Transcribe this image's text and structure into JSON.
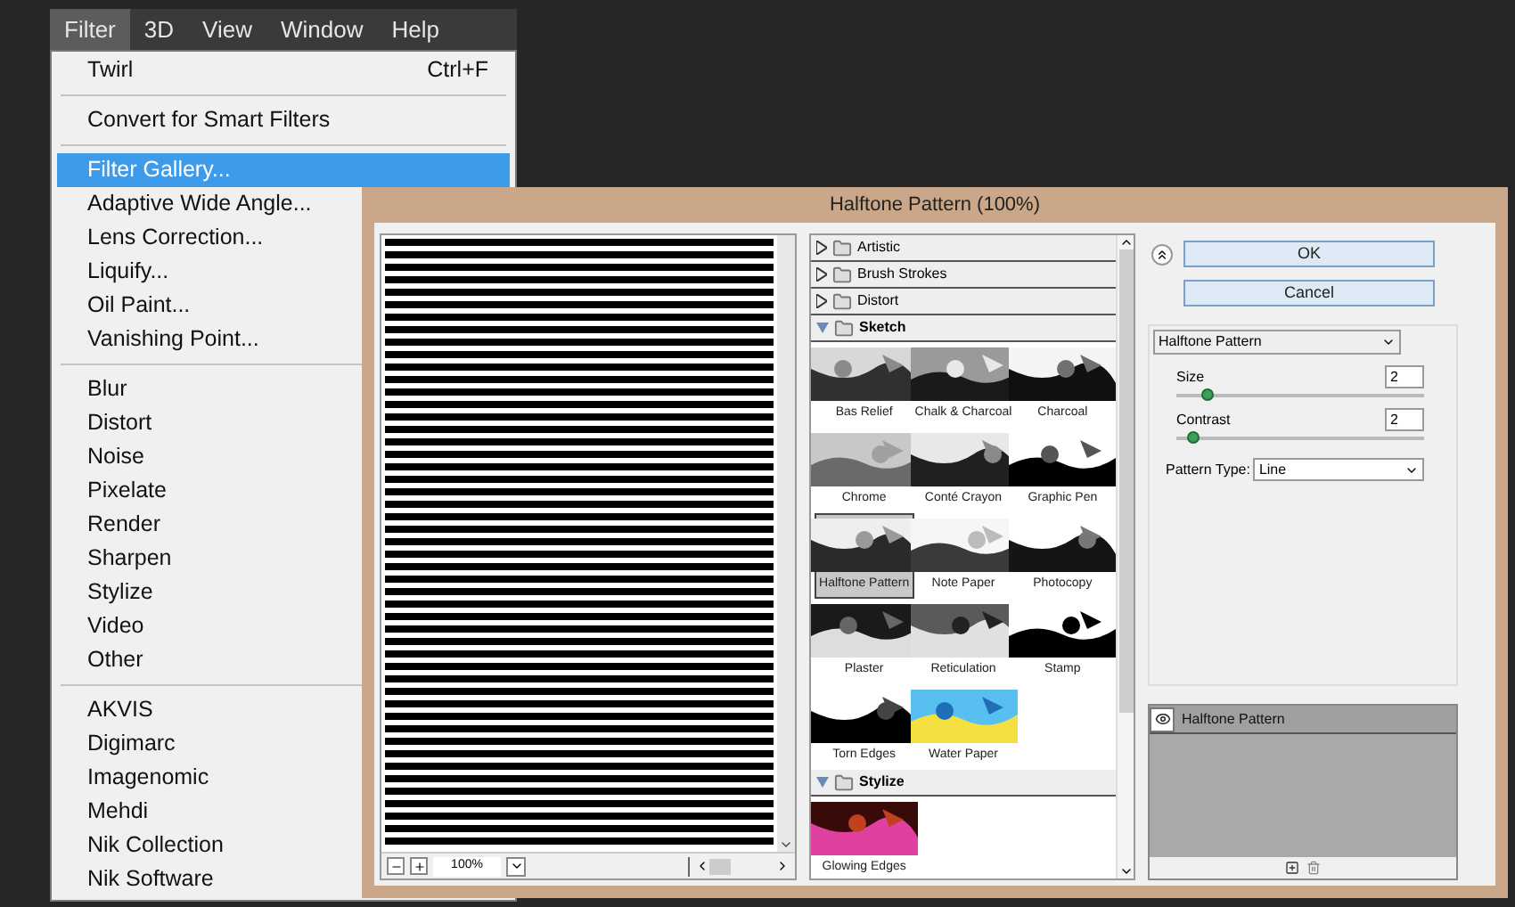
{
  "menu_bar": [
    {
      "label": "Filter",
      "selected": true
    },
    {
      "label": "3D",
      "selected": false
    },
    {
      "label": "View",
      "selected": false
    },
    {
      "label": "Window",
      "selected": false
    },
    {
      "label": "Help",
      "selected": false
    }
  ],
  "menu": {
    "groups": [
      [
        {
          "label": "Twirl",
          "shortcut": "Ctrl+F",
          "selected": false
        }
      ],
      [
        {
          "label": "Convert for Smart Filters",
          "selected": false
        }
      ],
      [
        {
          "label": "Filter Gallery...",
          "selected": true
        },
        {
          "label": "Adaptive Wide Angle...",
          "selected": false
        },
        {
          "label": "Lens Correction...",
          "selected": false
        },
        {
          "label": "Liquify...",
          "selected": false
        },
        {
          "label": "Oil Paint...",
          "selected": false
        },
        {
          "label": "Vanishing Point...",
          "selected": false
        }
      ],
      [
        {
          "label": "Blur",
          "selected": false
        },
        {
          "label": "Distort",
          "selected": false
        },
        {
          "label": "Noise",
          "selected": false
        },
        {
          "label": "Pixelate",
          "selected": false
        },
        {
          "label": "Render",
          "selected": false
        },
        {
          "label": "Sharpen",
          "selected": false
        },
        {
          "label": "Stylize",
          "selected": false
        },
        {
          "label": "Video",
          "selected": false
        },
        {
          "label": "Other",
          "selected": false
        }
      ],
      [
        {
          "label": "AKVIS",
          "selected": false
        },
        {
          "label": "Digimarc",
          "selected": false
        },
        {
          "label": "Imagenomic",
          "selected": false
        },
        {
          "label": "Mehdi",
          "selected": false
        },
        {
          "label": "Nik Collection",
          "selected": false
        },
        {
          "label": "Nik Software",
          "selected": false
        }
      ]
    ]
  },
  "dialog": {
    "title": "Halftone Pattern (100%)",
    "preview": {
      "zoom": "100%"
    },
    "categories": [
      {
        "name": "Artistic",
        "expanded": false
      },
      {
        "name": "Brush Strokes",
        "expanded": false
      },
      {
        "name": "Distort",
        "expanded": false
      },
      {
        "name": "Sketch",
        "expanded": true,
        "filters": [
          {
            "name": "Bas Relief",
            "selected": false
          },
          {
            "name": "Chalk & Charcoal",
            "selected": false
          },
          {
            "name": "Charcoal",
            "selected": false
          },
          {
            "name": "Chrome",
            "selected": false
          },
          {
            "name": "Conté Crayon",
            "selected": false
          },
          {
            "name": "Graphic Pen",
            "selected": false
          },
          {
            "name": "Halftone Pattern",
            "selected": true
          },
          {
            "name": "Note Paper",
            "selected": false
          },
          {
            "name": "Photocopy",
            "selected": false
          },
          {
            "name": "Plaster",
            "selected": false
          },
          {
            "name": "Reticulation",
            "selected": false
          },
          {
            "name": "Stamp",
            "selected": false
          },
          {
            "name": "Torn Edges",
            "selected": false
          },
          {
            "name": "Water Paper",
            "selected": false
          }
        ]
      },
      {
        "name": "Stylize",
        "expanded": true,
        "filters": [
          {
            "name": "Glowing Edges",
            "selected": false
          }
        ]
      }
    ],
    "buttons": [
      "OK",
      "Cancel"
    ],
    "filter_select": "Halftone Pattern",
    "params": [
      {
        "label": "Size",
        "value": "2",
        "level": 0.1
      },
      {
        "label": "Contrast",
        "value": "2",
        "level": 0.04
      }
    ],
    "pattern_type": {
      "label": "Pattern Type:",
      "value": "Line"
    },
    "layers": [
      {
        "name": "Halftone Pattern",
        "visible": true
      }
    ]
  }
}
